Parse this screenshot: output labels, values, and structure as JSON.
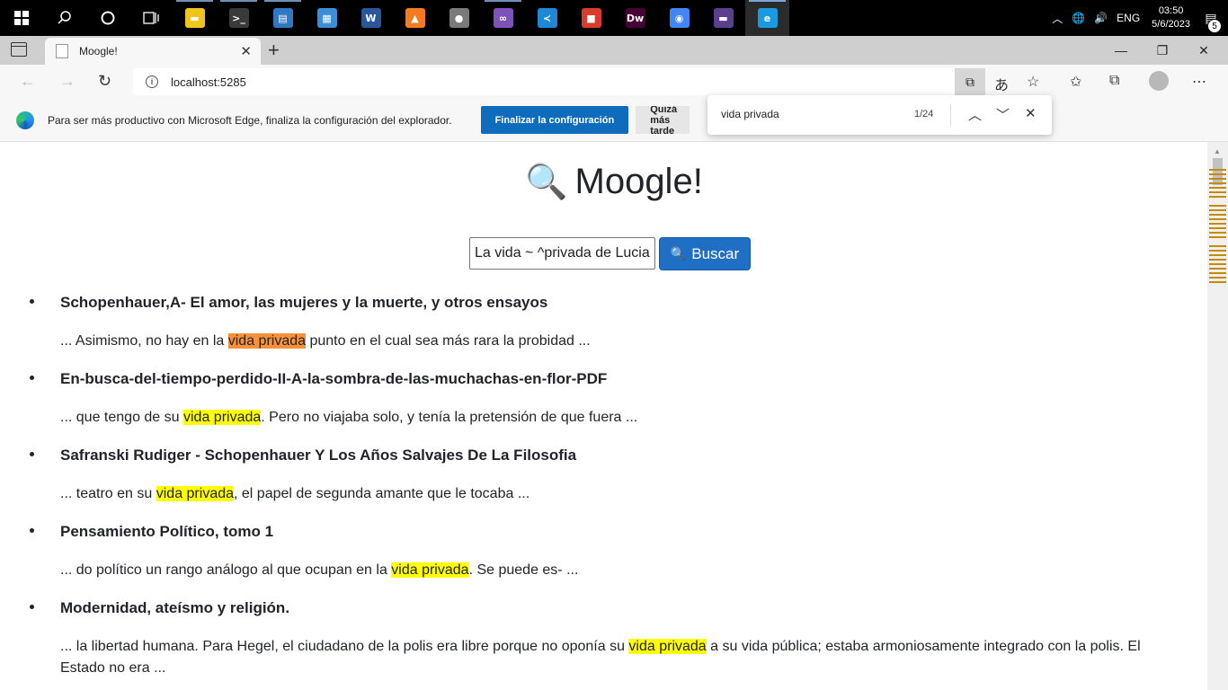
{
  "taskbar": {
    "apps": [
      {
        "name": "file-explorer",
        "glyph": "▬",
        "color": "#f0c419"
      },
      {
        "name": "terminal",
        "glyph": ">_",
        "color": "#3a3a3a"
      },
      {
        "name": "app-blue",
        "glyph": "▤",
        "color": "#2f78c4"
      },
      {
        "name": "app-control",
        "glyph": "▦",
        "color": "#3c8fd6"
      },
      {
        "name": "word",
        "glyph": "W",
        "color": "#2b579a"
      },
      {
        "name": "app-orange",
        "glyph": "▲",
        "color": "#f47b20"
      },
      {
        "name": "app-gray",
        "glyph": "●",
        "color": "#7a7a7a"
      },
      {
        "name": "visual-studio",
        "glyph": "∞",
        "color": "#7e52b8"
      },
      {
        "name": "vscode",
        "glyph": "≺",
        "color": "#1e88d6"
      },
      {
        "name": "app-tiles",
        "glyph": "■",
        "color": "#d93b2c"
      },
      {
        "name": "dreamweaver",
        "glyph": "Dw",
        "color": "#470137"
      },
      {
        "name": "chrome",
        "glyph": "◉",
        "color": "#4285f4"
      },
      {
        "name": "app-purple",
        "glyph": "▬",
        "color": "#5b3f8f"
      },
      {
        "name": "edge",
        "glyph": "e",
        "color": "#1a9ae0"
      }
    ],
    "language": "ENG",
    "time": "03:50",
    "date": "5/6/2023",
    "notifications": "5"
  },
  "browser": {
    "tab_title": "Moogle!",
    "url": "localhost:5285",
    "infobar_text": "Para ser más productivo con Microsoft Edge, finaliza la configuración del explorador.",
    "infobar_primary": "Finalizar la configuración",
    "infobar_secondary": "Quizá más tarde"
  },
  "find": {
    "query": "vida privada",
    "count": "1/24"
  },
  "page": {
    "title": "Moogle!",
    "search_value": "La vida ~ ^privada de Lucia",
    "search_button": "Buscar",
    "results": [
      {
        "title": "Schopenhauer,A- El amor, las mujeres y la muerte, y otros ensayos",
        "before": "... Asimismo, no hay en la ",
        "match": "vida privada",
        "after": " punto en el cual sea más rara la probidad ..."
      },
      {
        "title": "En-busca-del-tiempo-perdido-II-A-la-sombra-de-las-muchachas-en-flor-PDF",
        "before": "... que tengo de su ",
        "match": "vida privada",
        "after": ". Pero no viajaba solo, y tenía la pretensión de que fuera ..."
      },
      {
        "title": "Safranski Rudiger - Schopenhauer Y Los Años Salvajes De La Filosofia",
        "before": "... teatro en su ",
        "match": "vida privada",
        "after": ", el papel de segunda amante que le tocaba ..."
      },
      {
        "title": "Pensamiento Político, tomo 1",
        "before": "... do político un rango análogo al que ocupan en la ",
        "match": "vida privada",
        "after": ". Se puede es- ..."
      },
      {
        "title": "Modernidad, ateísmo y religión.",
        "before": "... la libertad humana. Para Hegel, el ciudadano de la polis era libre porque no oponía su ",
        "match": "vida privada",
        "after": " a su vida pública; estaba armoniosamente integrado con la polis. El Estado no era ..."
      }
    ]
  },
  "colors": {
    "highlight": "#ffff00",
    "active_highlight": "#f7923b",
    "primary_button": "#0f6cbd",
    "buscar_button": "#1f6fc5"
  }
}
